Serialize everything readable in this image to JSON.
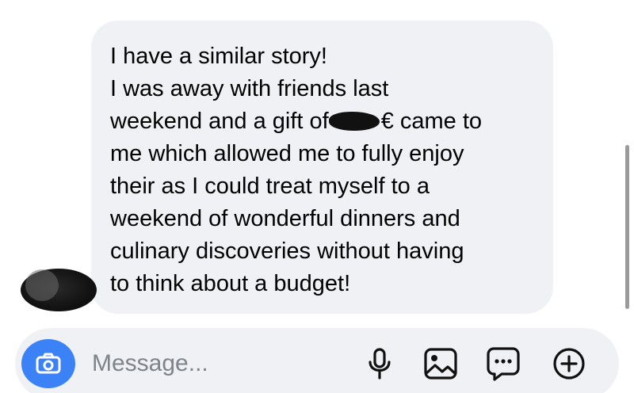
{
  "conversation": {
    "message": {
      "lines": [
        "I have a similar story!",
        "I was away with friends last",
        "weekend and a gift of",
        "€ came to",
        "me which allowed me to fully enjoy",
        "their as I could treat myself to a",
        "weekend of wonderful dinners and",
        "culinary discoveries without having",
        "to think about a budget!"
      ]
    }
  },
  "composer": {
    "placeholder": "Message...",
    "icons": [
      "camera-icon",
      "microphone-icon",
      "gallery-icon",
      "sticker-icon",
      "plus-icon"
    ]
  },
  "colors": {
    "bubble_background": "#eff1f4",
    "camera_button": "#3b82f6",
    "text": "#000000",
    "placeholder": "#7f838a"
  }
}
